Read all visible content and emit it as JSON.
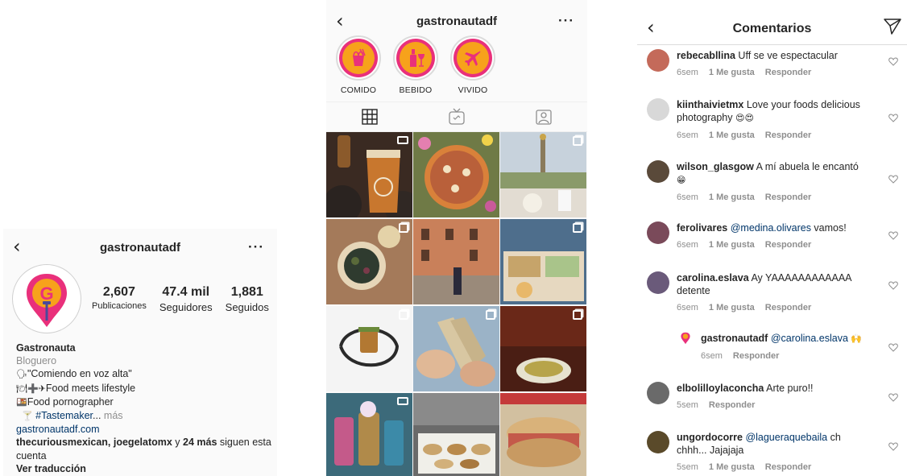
{
  "profile_panel": {
    "username": "gastronautadf",
    "stats": [
      {
        "value": "2,607",
        "label": "Publicaciones"
      },
      {
        "value": "47.4 mil",
        "label": "Seguidores"
      },
      {
        "value": "1,881",
        "label": "Seguidos"
      }
    ],
    "bio": {
      "name": "Gastronauta",
      "category": "Bloguero",
      "line1": "\"Comiendo en voz alta\"",
      "line2": "Food meets lifestyle",
      "line3": "Food pornographer",
      "hashtag": "#Tastemaker",
      "ellipsis": "...",
      "more": " más",
      "website": "gastronautadf.com",
      "followers_names": "thecuriousmexican, joegelatomx",
      "followers_joiner": " y ",
      "followers_count": "24 más",
      "followers_suffix": " siguen esta cuenta",
      "translate": "Ver traducción"
    },
    "icons": {
      "back": "back-chevron-icon",
      "more": "more-dots-icon",
      "logo": "gastronauta-pin-logo"
    },
    "colors": {
      "brand_pink": "#e9307b",
      "brand_orange": "#f7a21b",
      "link": "#003569"
    }
  },
  "grid_panel": {
    "username": "gastronautadf",
    "highlights": [
      {
        "label": "COMIDO",
        "icon": "noodle-box-icon"
      },
      {
        "label": "BEBIDO",
        "icon": "wine-bottle-icon"
      },
      {
        "label": "VIVIDO",
        "icon": "airplane-icon"
      }
    ],
    "tabs": [
      {
        "name": "grid",
        "icon": "grid-icon",
        "active": true
      },
      {
        "name": "igtv",
        "icon": "igtv-icon",
        "active": false
      },
      {
        "name": "tagged",
        "icon": "tagged-person-icon",
        "active": false
      }
    ],
    "tiles": [
      {
        "subject": "craft beer glass on volcanic rocks",
        "badge": "video",
        "colors": [
          "#3a2a22",
          "#c8772e",
          "#6b5b4e"
        ]
      },
      {
        "subject": "pizza with flowers",
        "badge": "",
        "colors": [
          "#7f8a4a",
          "#d9813a",
          "#b9603a"
        ]
      },
      {
        "subject": "monument and terrace lunch",
        "badge": "multiple",
        "colors": [
          "#c7d2dc",
          "#9aa27e",
          "#e2dcd2"
        ]
      },
      {
        "subject": "mushroom plate on wood",
        "badge": "multiple",
        "colors": [
          "#a47a5a",
          "#2f3b2f",
          "#d8c5a8"
        ]
      },
      {
        "subject": "man in piazza",
        "badge": "",
        "colors": [
          "#d99a6c",
          "#b9713f",
          "#7b5a3e"
        ]
      },
      {
        "subject": "airline meal tray",
        "badge": "multiple",
        "colors": [
          "#4e6e8c",
          "#c6a46a",
          "#e6d8c0"
        ]
      },
      {
        "subject": "plated dessert on white",
        "badge": "multiple",
        "colors": [
          "#f4f4f4",
          "#2a2a2a",
          "#b27832"
        ]
      },
      {
        "subject": "tamales held in hands",
        "badge": "multiple",
        "colors": [
          "#9bb3c7",
          "#d8c7a2",
          "#b79a72"
        ]
      },
      {
        "subject": "soup bowl in dark room",
        "badge": "multiple",
        "colors": [
          "#4a1e14",
          "#8b3020",
          "#e6e2cf"
        ]
      },
      {
        "subject": "colorful tiki cocktails",
        "badge": "video",
        "colors": [
          "#3c8aa8",
          "#c45a8a",
          "#b08a4a"
        ]
      },
      {
        "subject": "bakery counter",
        "badge": "",
        "colors": [
          "#6a6a6a",
          "#c9a46c",
          "#f0efe9"
        ]
      },
      {
        "subject": "torta sandwich",
        "badge": "",
        "colors": [
          "#d2c0a0",
          "#c45a4a",
          "#7c3a2a"
        ]
      }
    ]
  },
  "comments_panel": {
    "title": "Comentarios",
    "icons": {
      "back": "back-chevron-icon",
      "send": "send-paper-plane-icon",
      "like": "heart-icon"
    },
    "comments": [
      {
        "user": "rebecabllina",
        "mention": "",
        "text": " Uff se ve espectacular",
        "emoji": "",
        "age": "6sem",
        "likes": "1 Me gusta",
        "reply": "Responder",
        "avatar_color": "#c46a5a"
      },
      {
        "user": "kiinthaivietmx",
        "mention": "",
        "text": " Love your foods delicious photography",
        "emoji": "😍😍",
        "age": "6sem",
        "likes": "1 Me gusta",
        "reply": "Responder",
        "avatar_color": "#8a8a8a"
      },
      {
        "user": "wilson_glasgow",
        "mention": "",
        "text": " A mí abuela le encantó",
        "emoji": "😁",
        "age": "6sem",
        "likes": "1 Me gusta",
        "reply": "Responder",
        "avatar_color": "#5a4a3a"
      },
      {
        "user": "ferolivares",
        "mention": "@medina.olivares",
        "text": " vamos!",
        "emoji": "",
        "age": "6sem",
        "likes": "1 Me gusta",
        "reply": "Responder",
        "avatar_color": "#7a4a5a"
      },
      {
        "user": "carolina.eslava",
        "mention": "",
        "text": " Ay YAAAAAAAAAAAA detente",
        "emoji": "",
        "age": "6sem",
        "likes": "1 Me gusta",
        "reply": "Responder",
        "avatar_color": "#6a5a7a"
      },
      {
        "user": "gastronautadf",
        "mention": "@carolina.eslava",
        "text": " ",
        "emoji": "🙌",
        "age": "6sem",
        "likes": "",
        "reply": "Responder",
        "avatar_color": "#e9307b"
      },
      {
        "user": "elbolilloylaconcha",
        "mention": "",
        "text": " Arte puro!!",
        "emoji": "",
        "age": "5sem",
        "likes": "",
        "reply": "Responder",
        "avatar_color": "#6a6a6a"
      },
      {
        "user": "ungordocorre",
        "mention": "@lagueraquebaila",
        "text": " ch chhh... Jajajaja",
        "emoji": "",
        "age": "5sem",
        "likes": "1 Me gusta",
        "reply": "Responder",
        "avatar_color": "#5a4a2a"
      }
    ]
  }
}
